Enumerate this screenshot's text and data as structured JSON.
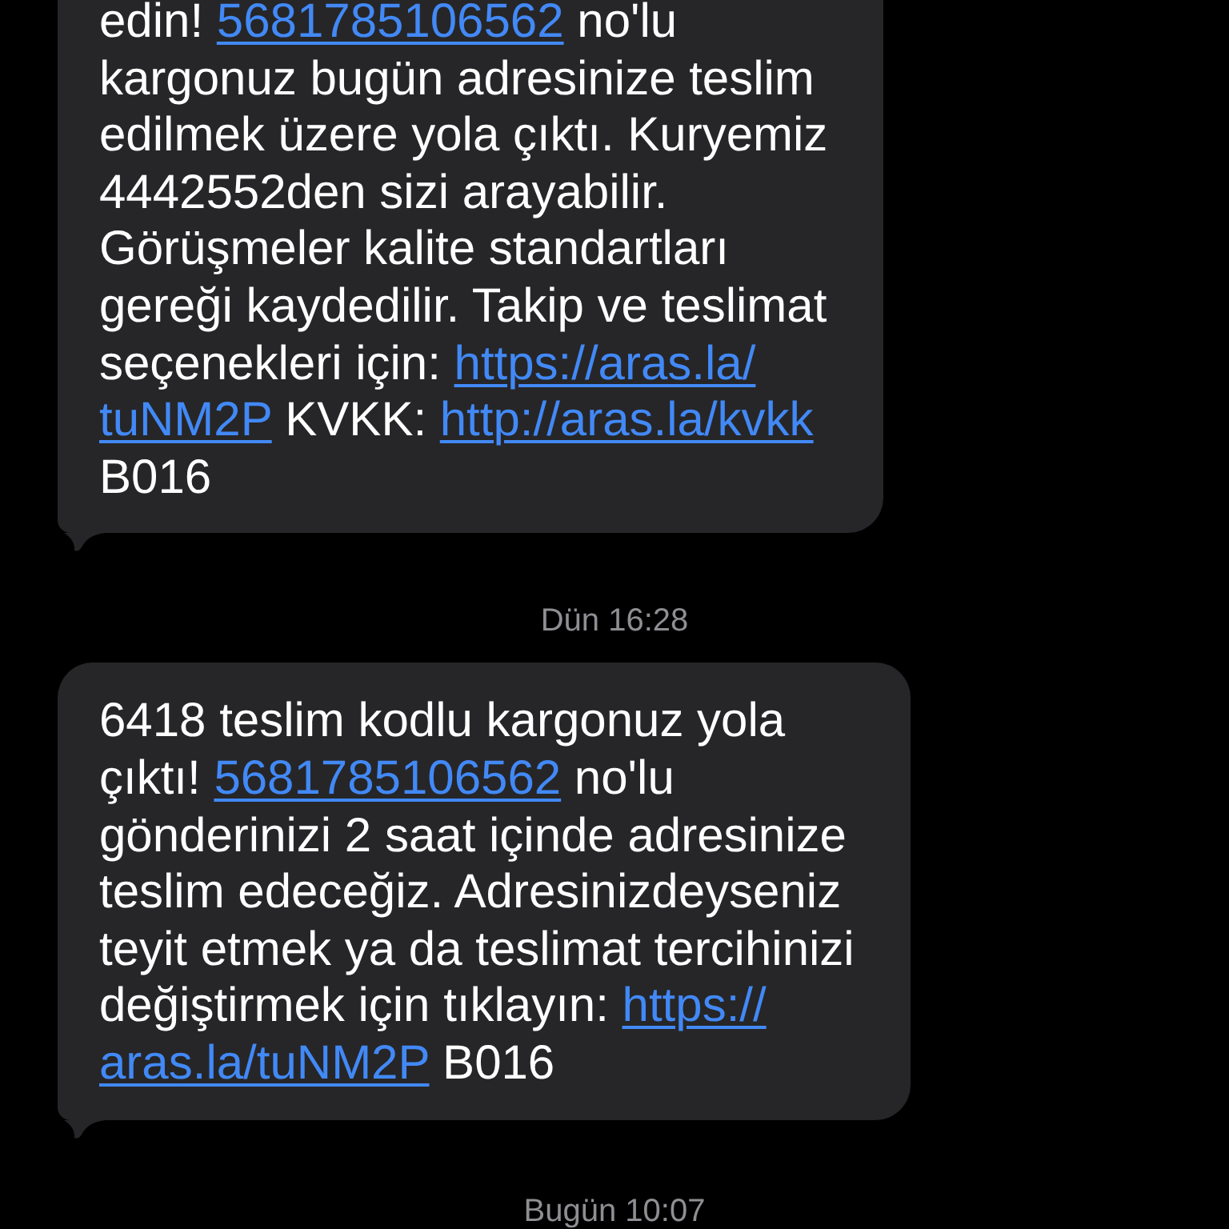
{
  "messages": [
    {
      "kind": "bubble",
      "lines": [
        [
          {
            "kind": "text",
            "text": "edin! "
          },
          {
            "kind": "link",
            "text": "5681785106562"
          },
          {
            "kind": "text",
            "text": " no'lu"
          }
        ],
        [
          {
            "kind": "text",
            "text": "kargonuz bugün adresinize teslim"
          }
        ],
        [
          {
            "kind": "text",
            "text": "edilmek üzere yola çıktı. Kuryemiz"
          }
        ],
        [
          {
            "kind": "text",
            "text": "4442552den sizi arayabilir."
          }
        ],
        [
          {
            "kind": "text",
            "text": "Görüşmeler kalite standartları"
          }
        ],
        [
          {
            "kind": "text",
            "text": "gereği kaydedilir. Takip ve teslimat"
          }
        ],
        [
          {
            "kind": "text",
            "text": "seçenekleri için: "
          },
          {
            "kind": "link",
            "text": "https://aras.la/"
          }
        ],
        [
          {
            "kind": "link",
            "text": "tuNM2P"
          },
          {
            "kind": "text",
            "text": " KVKK: "
          },
          {
            "kind": "link",
            "text": "http://aras.la/kvkk"
          }
        ],
        [
          {
            "kind": "text",
            "text": "B016"
          }
        ]
      ]
    },
    {
      "kind": "timestamp",
      "text": "Dün 16:28"
    },
    {
      "kind": "bubble",
      "lines": [
        [
          {
            "kind": "text",
            "text": "6418 teslim kodlu kargonuz yola"
          }
        ],
        [
          {
            "kind": "text",
            "text": "çıktı! "
          },
          {
            "kind": "link",
            "text": "5681785106562"
          },
          {
            "kind": "text",
            "text": " no'lu"
          }
        ],
        [
          {
            "kind": "text",
            "text": "gönderinizi 2 saat içinde adresinize"
          }
        ],
        [
          {
            "kind": "text",
            "text": "teslim edeceğiz. Adresinizdeyseniz"
          }
        ],
        [
          {
            "kind": "text",
            "text": "teyit etmek ya da teslimat tercihinizi"
          }
        ],
        [
          {
            "kind": "text",
            "text": "değiştirmek için tıklayın: "
          },
          {
            "kind": "link",
            "text": "https://"
          }
        ],
        [
          {
            "kind": "link",
            "text": "aras.la/tuNM2P"
          },
          {
            "kind": "text",
            "text": " B016"
          }
        ]
      ]
    },
    {
      "kind": "timestamp",
      "text": "Bugün 10:07"
    }
  ]
}
